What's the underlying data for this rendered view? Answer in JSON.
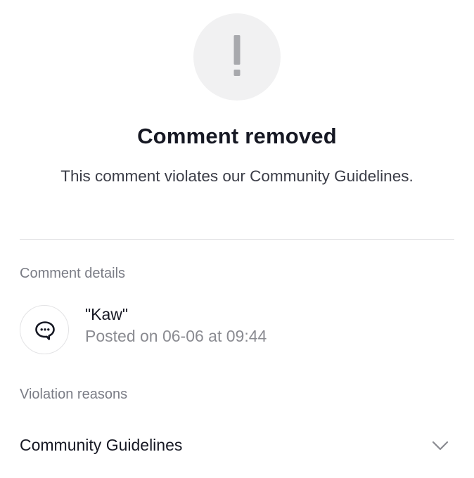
{
  "header": {
    "icon": "exclamation-icon",
    "title": "Comment removed",
    "subtitle": "This comment violates our Community Guidelines."
  },
  "details": {
    "section_label": "Comment details",
    "icon": "chat-bubble-icon",
    "comment_text": "\"Kaw\"",
    "posted_text": "Posted on 06-06 at 09:44"
  },
  "violations": {
    "section_label": "Violation reasons",
    "items": [
      {
        "label": "Community Guidelines",
        "icon": "chevron-down-icon"
      }
    ]
  },
  "colors": {
    "text_primary": "#161823",
    "text_secondary": "#8a8b91",
    "icon_circle_bg": "#f1f1f2",
    "exclamation": "#a8a9ad",
    "divider": "#e3e3e5"
  }
}
